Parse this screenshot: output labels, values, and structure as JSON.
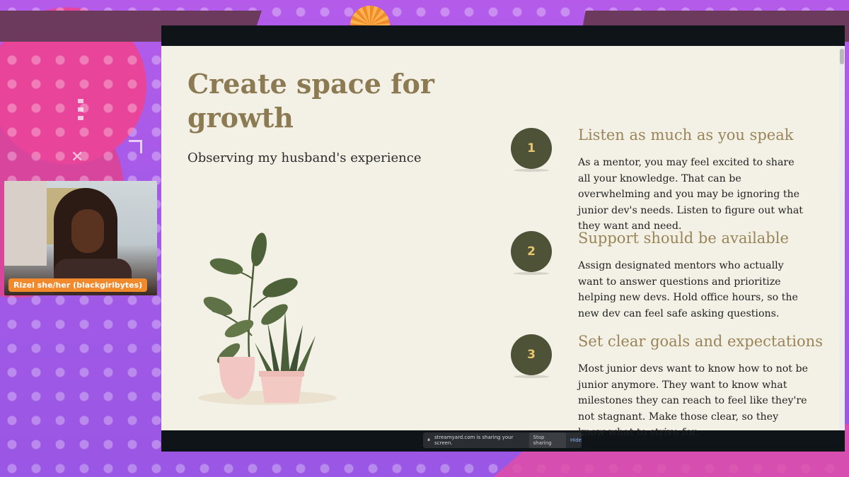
{
  "slide": {
    "title": "Create space for growth",
    "subtitle": "Observing my husband's experience",
    "steps": [
      {
        "number": "1",
        "heading": "Listen as much as you speak",
        "body": "As a mentor, you may feel excited to share all your knowledge. That can be overwhelming and you may be ignoring the junior dev's needs. Listen to figure out what they want and need."
      },
      {
        "number": "2",
        "heading": "Support should be available",
        "body": "Assign designated mentors who actually want to answer questions and prioritize helping new devs. Hold office hours, so the new dev can feel safe asking questions."
      },
      {
        "number": "3",
        "heading": "Set clear goals and expectations",
        "body": "Most junior devs want to know how to not be junior anymore. They want to know what milestones they can reach to feel like they're not stagnant. Make those clear, so they know what to strive for."
      }
    ]
  },
  "camera": {
    "name_tag": "Rizel she/her (blackgirlbytes)"
  },
  "share_bar": {
    "pause_icon": "⏸",
    "message": "streamyard.com is sharing your screen.",
    "stop_label": "Stop sharing",
    "hide_label": "Hide"
  },
  "colors": {
    "title": "#8c7a52",
    "step_circle": "#4e5337",
    "step_number": "#e8c56e",
    "name_tag": "#f08a2d",
    "background": "#a259e6"
  }
}
